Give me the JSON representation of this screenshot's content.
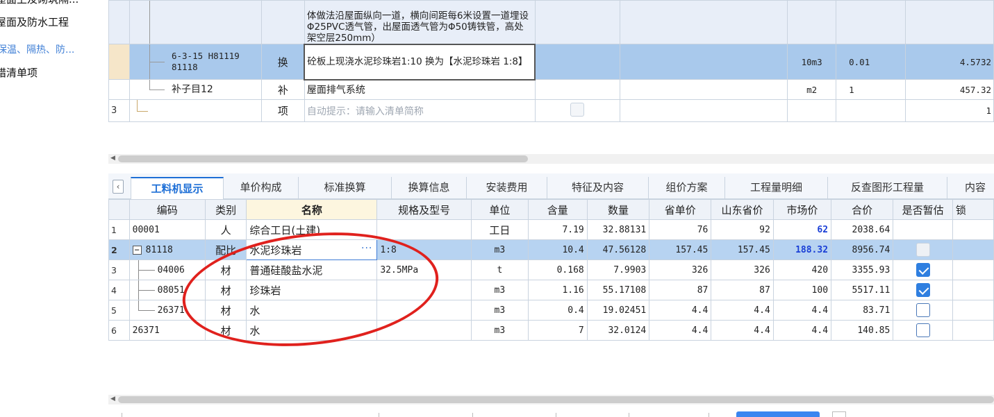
{
  "left_tree": {
    "items": [
      "屋面及防水工程",
      "保温、隔热、防...",
      "措清单项"
    ],
    "partial_top": "屋面上及砌筑隔..."
  },
  "upper_grid": {
    "row_a": {
      "desc": "体做法沿屋面纵向一道，横向间距每6米设置一道埋设Φ25PVC透气管，出屋面透气管为Φ50铸铁管，高处架空层250mm）"
    },
    "row_b": {
      "code_line1": "6-3-15 H81119",
      "code_line2": "81118",
      "type": "换",
      "desc": "砼板上现浇水泥珍珠岩1:10  换为【水泥珍珠岩 1:8】",
      "unit": "10m3",
      "qty": "0.01",
      "price": "4.5732"
    },
    "row_c": {
      "code": "补子目12",
      "type": "补",
      "desc": "屋面排气系统",
      "unit": "m2",
      "qty": "1",
      "price": "457.32"
    },
    "row_d": {
      "num": "3",
      "type": "项",
      "desc_placeholder": "自动提示：请输入清单简称",
      "price": "1"
    }
  },
  "tabs": [
    "工料机显示",
    "单价构成",
    "标准换算",
    "换算信息",
    "安装费用",
    "特征及内容",
    "组价方案",
    "工程量明细",
    "反查图形工程量",
    "内容"
  ],
  "lower_grid": {
    "headers": [
      "编码",
      "类别",
      "名称",
      "规格及型号",
      "单位",
      "含量",
      "数量",
      "省单价",
      "山东省价",
      "市场价",
      "合价",
      "是否暂估",
      "锁"
    ],
    "rows": [
      {
        "n": "1",
        "code": "00001",
        "cat": "人",
        "name": "综合工日(土建)",
        "spec": "",
        "unit": "工日",
        "content": "7.19",
        "qty": "32.88131",
        "prov": "76",
        "sd": "92",
        "market": "62",
        "total": "2038.64",
        "est": "none"
      },
      {
        "n": "2",
        "code": "81118",
        "cat": "配比",
        "name": "水泥珍珠岩",
        "spec": "1:8",
        "unit": "m3",
        "content": "10.4",
        "qty": "47.56128",
        "prov": "157.45",
        "sd": "157.45",
        "market": "188.32",
        "total": "8956.74",
        "est": "disabled"
      },
      {
        "n": "3",
        "code": "04006",
        "cat": "材",
        "name": "普通硅酸盐水泥",
        "spec": "32.5MPa",
        "unit": "t",
        "content": "0.168",
        "qty": "7.9903",
        "prov": "326",
        "sd": "326",
        "market": "420",
        "total": "3355.93",
        "est": "checked"
      },
      {
        "n": "4",
        "code": "08051",
        "cat": "材",
        "name": "珍珠岩",
        "spec": "",
        "unit": "m3",
        "content": "1.16",
        "qty": "55.17108",
        "prov": "87",
        "sd": "87",
        "market": "100",
        "total": "5517.11",
        "est": "checked"
      },
      {
        "n": "5",
        "code": "26371",
        "cat": "材",
        "name": "水",
        "spec": "",
        "unit": "m3",
        "content": "0.4",
        "qty": "19.02451",
        "prov": "4.4",
        "sd": "4.4",
        "market": "4.4",
        "total": "83.71",
        "est": "unchecked"
      },
      {
        "n": "6",
        "code": "26371",
        "cat": "材",
        "name": "水",
        "spec": "",
        "unit": "m3",
        "content": "7",
        "qty": "32.0124",
        "prov": "4.4",
        "sd": "4.4",
        "market": "4.4",
        "total": "140.85",
        "est": "unchecked"
      }
    ],
    "collapse_symbol": "−",
    "more_symbol": "···"
  },
  "colors": {
    "selected_row": "#b7d3f1",
    "active_tab": "#1e6fd6",
    "annotation": "#e0211d",
    "market_price_highlight": "#1a3fd6"
  },
  "icons": {
    "tab_scroll_left": "‹",
    "scroll_left": "◀"
  }
}
